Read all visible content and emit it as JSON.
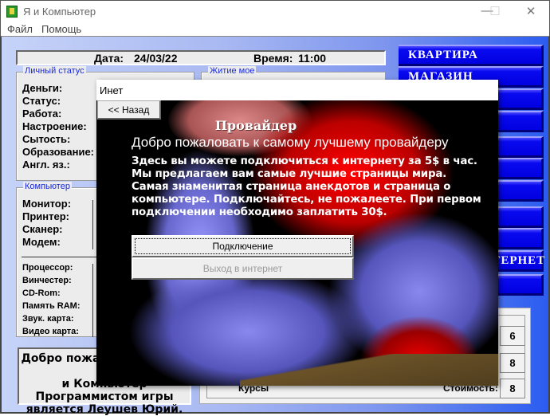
{
  "window": {
    "title": "Я и Компьютер",
    "minimize": "—",
    "maximize": "☐",
    "close": "✕"
  },
  "menu": {
    "file": "Файл",
    "help": "Помощь"
  },
  "status_bar": {
    "date_label": "Дата:",
    "date": "24/03/22",
    "time_label": "Время:",
    "time": "11:00"
  },
  "personal": {
    "legend": "Личный статус",
    "labels": [
      "Деньги:",
      "Статус:",
      "Работа:",
      "Настроение:",
      "Сытость:",
      "Образование:",
      "Англ. яз.:"
    ]
  },
  "life": {
    "legend": "Житие мое"
  },
  "computer": {
    "legend": "Компьютер",
    "peripherals": [
      "Монитор:",
      "Принтер:",
      "Сканер:",
      "Модем:"
    ],
    "components": [
      "Процессор:",
      "Винчестер:",
      "CD-Rom:",
      "Память RAM:",
      "Звук. карта:",
      "Видео карта:"
    ]
  },
  "welcome_box": {
    "lines": [
      "Добро пожаловать в игру Я",
      "и Компьютер",
      "Программистом игры",
      "является Леушев Юрий."
    ]
  },
  "nav": [
    "КВАРТИРА",
    "МАГАЗИН",
    "",
    "",
    "",
    "",
    "",
    "",
    "",
    "ИНТЕРНЕТ",
    ""
  ],
  "courses": {
    "label": "Курсы",
    "cost_label": "Стоимость:",
    "values": [
      "6",
      "8",
      "8"
    ]
  },
  "dialog": {
    "title": "Инет",
    "back": "<< Назад",
    "heading": "Провайдер",
    "welcome": "Добро пожаловать к самому лучшему провайдеру",
    "paragraph": "Здесь вы можете подключиться к интернету за 5$ в час. Мы предлагаем вам самые лучшие страницы мира. Самая знаменитая страница анекдотов  и страница о компьютере. Подключайтесь, не пожалеете. При первом подключении необходимо заплатить 30$.",
    "connect": "Подключение",
    "go_online": "Выход в интернет"
  }
}
